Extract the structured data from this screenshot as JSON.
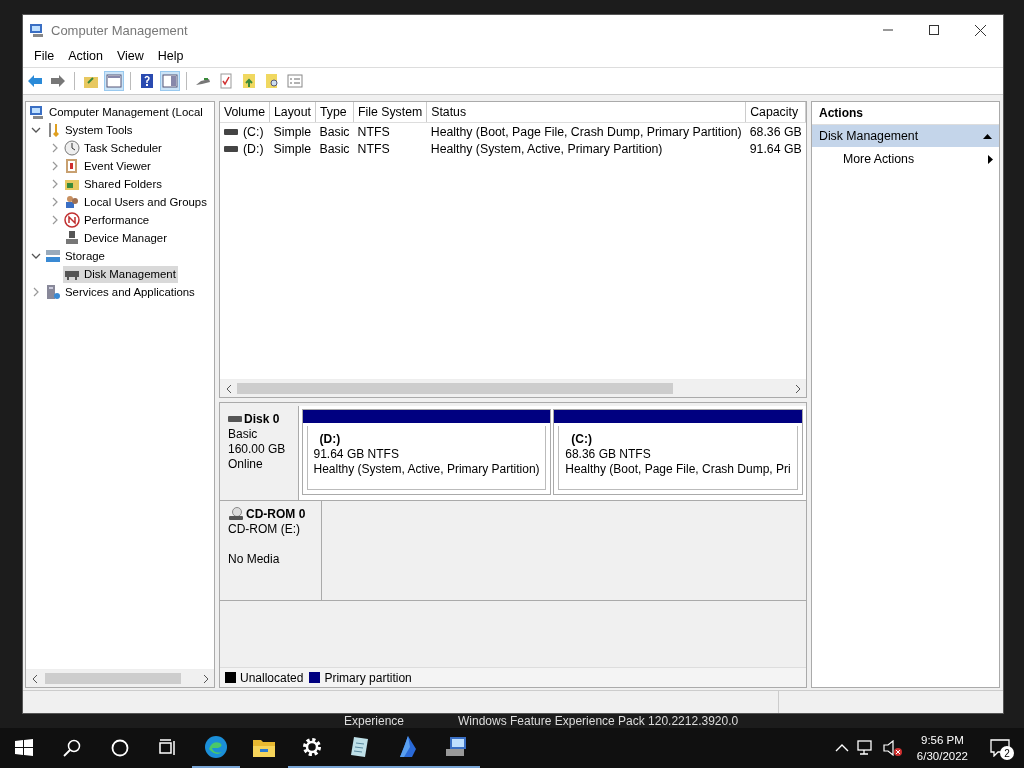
{
  "window": {
    "title": "Computer Management"
  },
  "menu": [
    "File",
    "Action",
    "View",
    "Help"
  ],
  "tree": [
    {
      "label": "Computer Management (Local",
      "selected": false,
      "children": [
        {
          "label": "System Tools",
          "expanded": true,
          "selected": false,
          "children": [
            {
              "label": "Task Scheduler",
              "expanded": false,
              "selected": false
            },
            {
              "label": "Event Viewer",
              "expanded": false,
              "selected": false
            },
            {
              "label": "Shared Folders",
              "expanded": false,
              "selected": false
            },
            {
              "label": "Local Users and Groups",
              "expanded": false,
              "selected": false
            },
            {
              "label": "Performance",
              "expanded": false,
              "selected": false
            },
            {
              "label": "Device Manager",
              "selected": false
            }
          ]
        },
        {
          "label": "Storage",
          "expanded": true,
          "selected": false,
          "children": [
            {
              "label": "Disk Management",
              "selected": true
            }
          ]
        },
        {
          "label": "Services and Applications",
          "expanded": false,
          "selected": false
        }
      ]
    }
  ],
  "volumes": {
    "columns": [
      "Volume",
      "Layout",
      "Type",
      "File System",
      "Status",
      "Capacity"
    ],
    "rows": [
      [
        "(C:)",
        "Simple",
        "Basic",
        "NTFS",
        "Healthy (Boot, Page File, Crash Dump, Primary Partition)",
        "68.36 GB"
      ],
      [
        "(D:)",
        "Simple",
        "Basic",
        "NTFS",
        "Healthy (System, Active, Primary Partition)",
        "91.64 GB"
      ]
    ]
  },
  "disks": [
    {
      "kind": "disk",
      "name": "Disk 0",
      "type": "Basic",
      "size": "160.00 GB",
      "status": "Online",
      "partitions": [
        {
          "label": "(D:)",
          "size": "91.64 GB NTFS",
          "status": "Healthy (System, Active, Primary Partition)",
          "color": "#000080"
        },
        {
          "label": "(C:)",
          "size": "68.36 GB NTFS",
          "status": "Healthy (Boot, Page File, Crash Dump, Pri",
          "color": "#000080"
        }
      ]
    },
    {
      "kind": "cdrom",
      "name": "CD-ROM 0",
      "type": "CD-ROM (E:)",
      "status": "No Media"
    }
  ],
  "legend": [
    {
      "label": "Unallocated",
      "color": "#000000"
    },
    {
      "label": "Primary partition",
      "color": "#000080"
    }
  ],
  "actions": {
    "title": "Actions",
    "section": "Disk Management",
    "items": [
      "More Actions"
    ]
  },
  "background_text": [
    "Experience",
    "Windows Feature Experience Pack 120.2212.3920.0"
  ],
  "taskbar": {
    "time": "9:56 PM",
    "date": "6/30/2022",
    "notifications": "2"
  }
}
